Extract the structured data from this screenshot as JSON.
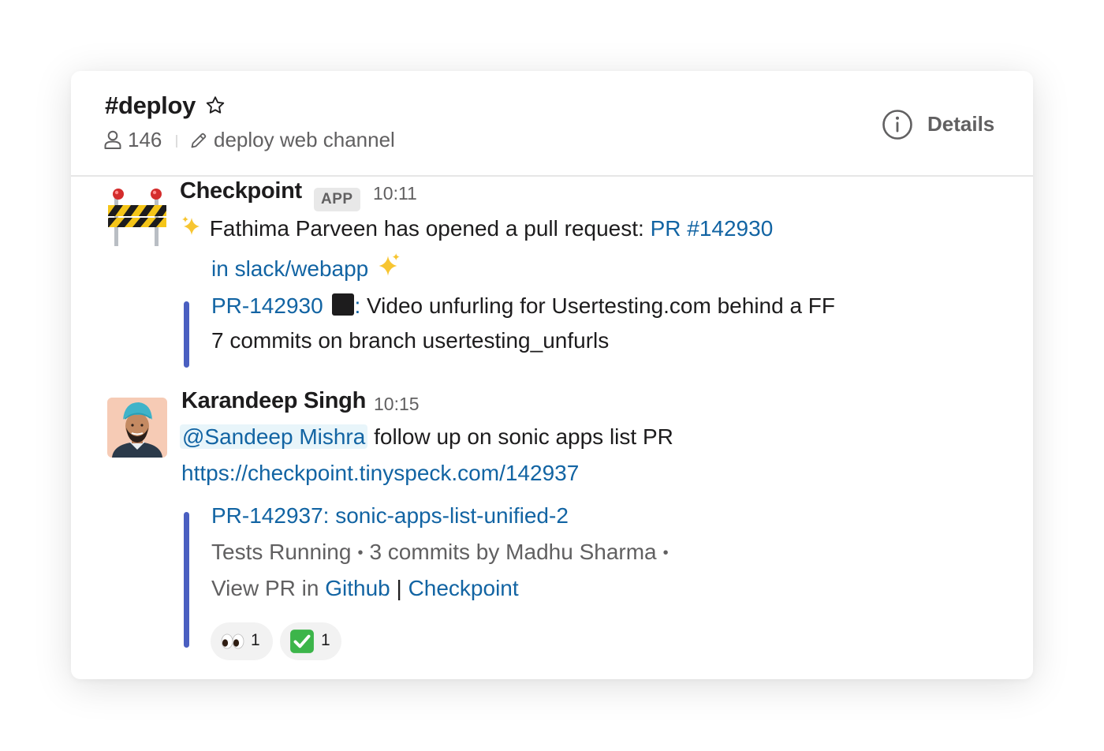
{
  "channel": {
    "name": "#deploy",
    "member_count": "146",
    "topic": "deploy web channel",
    "details_label": "Details"
  },
  "messages": [
    {
      "sender": "Checkpoint",
      "badge": "APP",
      "time": "10:11",
      "avatar_icon": "construction-barrier-icon",
      "text_prefix": "Fathima Parveen has opened a pull request:",
      "pr_link": "PR #142930",
      "repo_link": "in slack/webapp",
      "attachment": {
        "pr_id": "PR-142930",
        "separator": ":",
        "title": "Video unfurling for Usertesting.com behind a FF",
        "subtitle": "7 commits on branch usertesting_unfurls"
      }
    },
    {
      "sender": "Karandeep Singh",
      "time": "10:15",
      "avatar_icon": "user-avatar-photo",
      "mention": "@Sandeep Mishra",
      "text": "follow up on sonic apps list PR",
      "url": "https://checkpoint.tinyspeck.com/142937",
      "attachment": {
        "title": "PR-142937: sonic-apps-list-unified-2",
        "status": "Tests Running",
        "commits": "3 commits by",
        "author": "Madhu Sharma",
        "view_prefix": "View PR in",
        "github_link": "Github",
        "pipe": "|",
        "checkpoint_link": "Checkpoint"
      },
      "reactions": [
        {
          "icon": "eyes-icon",
          "count": "1"
        },
        {
          "icon": "check-mark-icon",
          "count": "1"
        }
      ]
    }
  ],
  "colors": {
    "link": "#1264a3",
    "attachment_bar": "#4a5fc1",
    "muted_text": "#616061",
    "mention_bg": "#e8f5fa"
  }
}
